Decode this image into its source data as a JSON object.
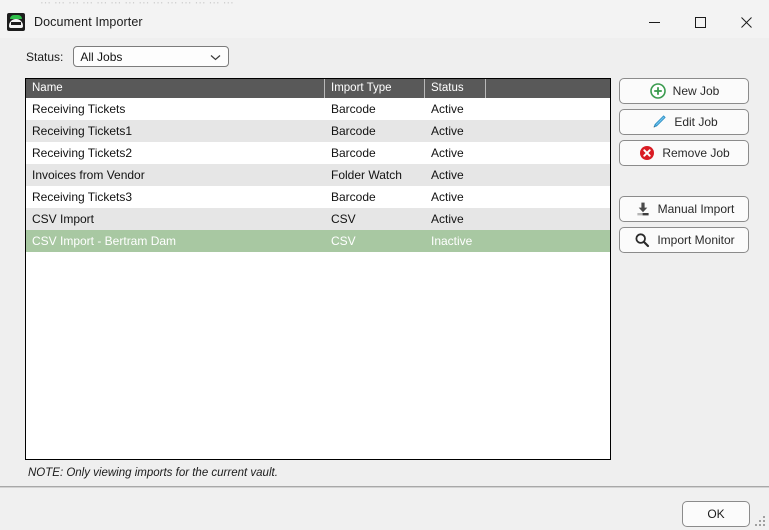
{
  "background_window": {
    "faint_text": "⋯ ⋯ ⋯ ⋯ ⋯ ⋯ ⋯ ⋯ ⋯ ⋯ ⋯ ⋯ ⋯ ⋯"
  },
  "titlebar": {
    "icon": "document-importer-app-icon",
    "title": "Document Importer",
    "minimize_label": "Minimize",
    "maximize_label": "Maximize",
    "close_label": "Close"
  },
  "filter": {
    "label": "Status:",
    "selected": "All Jobs",
    "options": [
      "All Jobs"
    ],
    "arrow_icon": "chevron-down-icon"
  },
  "list": {
    "columns": [
      {
        "key": "name",
        "label": "Name"
      },
      {
        "key": "import_type",
        "label": "Import Type"
      },
      {
        "key": "status",
        "label": "Status"
      },
      {
        "key": "extra",
        "label": ""
      }
    ],
    "rows": [
      {
        "name": "Receiving Tickets",
        "import_type": "Barcode",
        "status": "Active",
        "extra": "",
        "selected": false
      },
      {
        "name": "Receiving Tickets1",
        "import_type": "Barcode",
        "status": "Active",
        "extra": "",
        "selected": false
      },
      {
        "name": "Receiving Tickets2",
        "import_type": "Barcode",
        "status": "Active",
        "extra": "",
        "selected": false
      },
      {
        "name": "Invoices from Vendor",
        "import_type": "Folder Watch",
        "status": "Active",
        "extra": "",
        "selected": false
      },
      {
        "name": "Receiving Tickets3",
        "import_type": "Barcode",
        "status": "Active",
        "extra": "",
        "selected": false
      },
      {
        "name": "CSV Import",
        "import_type": "CSV",
        "status": "Active",
        "extra": "",
        "selected": false
      },
      {
        "name": "CSV Import - Bertram Dam",
        "import_type": "CSV",
        "status": "Inactive",
        "extra": "",
        "selected": true
      }
    ],
    "selection_color": "#a8c8a2"
  },
  "note": "NOTE: Only viewing imports for the current vault.",
  "side_buttons": [
    {
      "label": "New Job",
      "icon": "plus-circle-icon",
      "color": "#3a9b4e"
    },
    {
      "label": "Edit Job",
      "icon": "pencil-icon",
      "color": "#3aa5e0"
    },
    {
      "label": "Remove Job",
      "icon": "delete-circle-icon",
      "color": "#d91b23"
    }
  ],
  "side_buttons_group2": [
    {
      "label": "Manual Import",
      "icon": "download-tray-icon",
      "color": "#4a4a4a"
    },
    {
      "label": "Import Monitor",
      "icon": "search-icon",
      "color": "#2a2a2a"
    }
  ],
  "footer": {
    "ok_label": "OK",
    "resize_grip": "resize-grip-icon"
  }
}
